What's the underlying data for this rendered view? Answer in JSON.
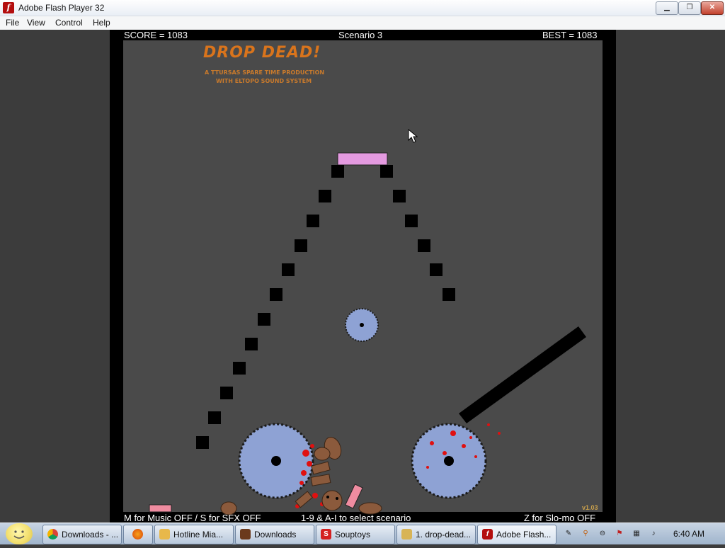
{
  "window": {
    "title": "Adobe Flash Player 32"
  },
  "menu": [
    "File",
    "View",
    "Control",
    "Help"
  ],
  "hud": {
    "score": "SCORE = 1083",
    "scenario": "Scenario 3",
    "best": "BEST = 1083",
    "music_hint": "M for Music OFF / S for SFX OFF",
    "select_hint": "1-9 & A-I to select scenario",
    "slowmo_hint": "Z for Slo-mo OFF"
  },
  "logo": {
    "title": "DROP DEAD!",
    "line1": "A TTURSAS SPARE TIME PRODUCTION",
    "line2": "WITH ELTOPO SOUND SYSTEM"
  },
  "version": "v1.03",
  "colors": {
    "playfield": "#4a4a4a",
    "saw": "#8ea2d4",
    "blood": "#e01010",
    "pink_platform": "#e49ae0",
    "bear": "#8b5a3c",
    "logo": "#d9741c"
  },
  "taskbar": {
    "items": [
      {
        "label": "Downloads - ...",
        "icon": "chrome-icon"
      },
      {
        "label": "",
        "icon": "firefox-icon"
      },
      {
        "label": "Hotline Mia...",
        "icon": "folder-icon"
      },
      {
        "label": "Downloads",
        "icon": "downloads-icon"
      },
      {
        "label": "Souptoys",
        "icon": "souptoys-icon"
      },
      {
        "label": "1. drop-dead...",
        "icon": "notepad-icon"
      },
      {
        "label": "Adobe Flash...",
        "icon": "flash-icon"
      }
    ],
    "clock": "6:40 AM"
  }
}
